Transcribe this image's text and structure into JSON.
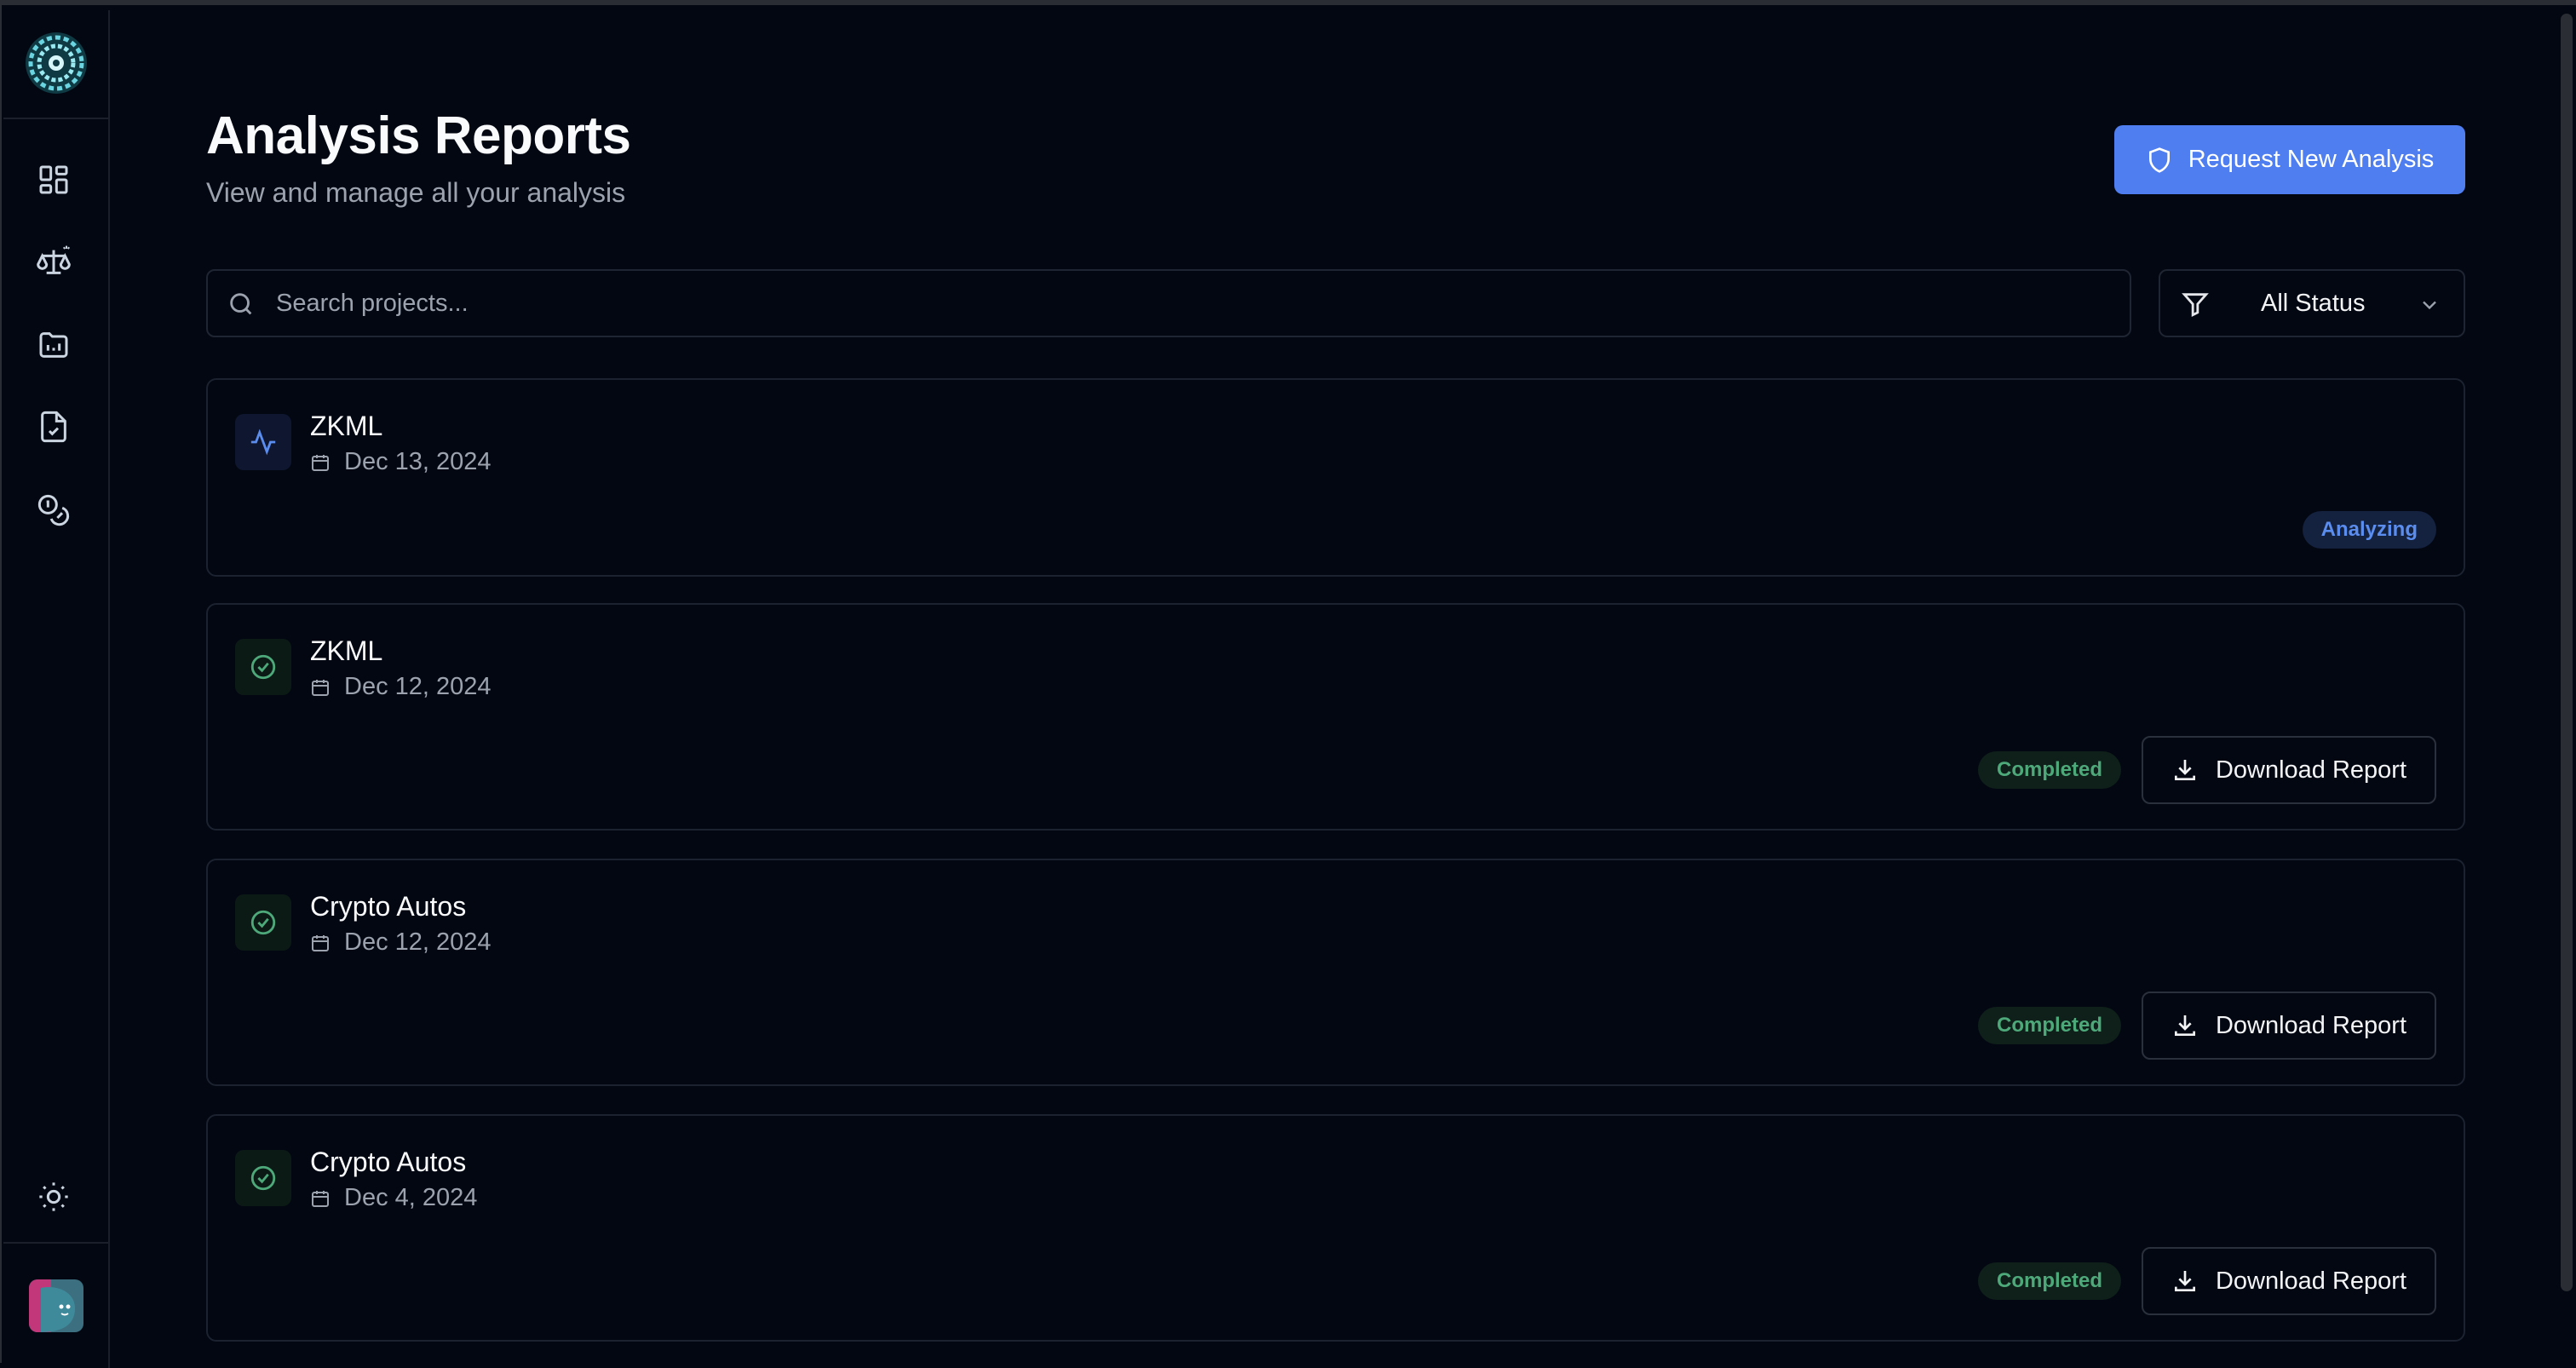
{
  "header": {
    "title": "Analysis Reports",
    "subtitle": "View and manage all your analysis",
    "request_button": "Request New Analysis"
  },
  "search": {
    "placeholder": "Search projects...",
    "value": ""
  },
  "filter": {
    "selected": "All Status"
  },
  "sidebar": {
    "items": [
      {
        "icon": "dashboard-icon"
      },
      {
        "icon": "scale-icon"
      },
      {
        "icon": "folder-chart-icon"
      },
      {
        "icon": "file-check-icon"
      },
      {
        "icon": "coins-icon"
      }
    ],
    "theme_icon": "sun-icon"
  },
  "reports": [
    {
      "name": "ZKML",
      "date": "Dec 13, 2024",
      "status": "Analyzing",
      "icon": "activity-icon",
      "action": ""
    },
    {
      "name": "ZKML",
      "date": "Dec 12, 2024",
      "status": "Completed",
      "icon": "check-circle-icon",
      "action": "Download Report"
    },
    {
      "name": "Crypto Autos",
      "date": "Dec 12, 2024",
      "status": "Completed",
      "icon": "check-circle-icon",
      "action": "Download Report"
    },
    {
      "name": "Crypto Autos",
      "date": "Dec 4, 2024",
      "status": "Completed",
      "icon": "check-circle-icon",
      "action": "Download Report"
    }
  ],
  "colors": {
    "background": "#030712",
    "accent": "#4f7ef0",
    "analyzing": "#5b8def",
    "completed": "#4ea97a"
  }
}
